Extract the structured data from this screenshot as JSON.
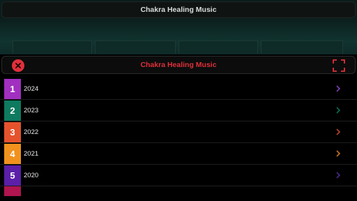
{
  "app": {
    "title": "Chakra Healing Music"
  },
  "modal": {
    "title": "Chakra Healing Music",
    "close_icon": "close-icon",
    "expand_icon": "fullscreen-icon"
  },
  "colors": {
    "accent": "#e0303a"
  },
  "items": [
    {
      "number": "1",
      "year": "2024",
      "color": "#a12fc0",
      "chevron": "#7a3fb0"
    },
    {
      "number": "2",
      "year": "2023",
      "color": "#0e7a5f",
      "chevron": "#0e6a52"
    },
    {
      "number": "3",
      "year": "2022",
      "color": "#e5532d",
      "chevron": "#b3452a"
    },
    {
      "number": "4",
      "year": "2021",
      "color": "#f0921d",
      "chevron": "#c0702a"
    },
    {
      "number": "5",
      "year": "2020",
      "color": "#5b1fa8",
      "chevron": "#4a2a8a"
    },
    {
      "number": "",
      "year": "",
      "color": "#b0154f",
      "chevron": "#000000"
    }
  ]
}
